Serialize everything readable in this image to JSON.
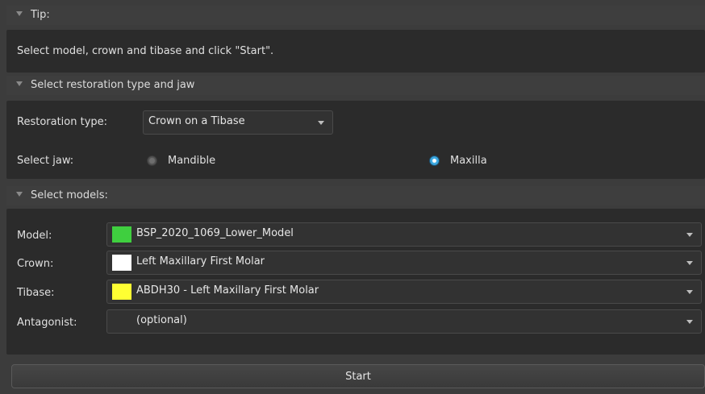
{
  "tip": {
    "header": "Tip:",
    "text": "Select model, crown and tibase and click \"Start\"."
  },
  "restoration": {
    "header": "Select restoration type and jaw",
    "type_label": "Restoration type:",
    "type_value": "Crown on a Tibase",
    "jaw_label": "Select jaw:",
    "options": [
      {
        "label": "Mandible",
        "checked": false
      },
      {
        "label": "Maxilla",
        "checked": true
      }
    ]
  },
  "models": {
    "header": "Select models:",
    "rows": [
      {
        "label": "Model:",
        "value": "BSP_2020_1069_Lower_Model",
        "swatch": "#3fcf3f"
      },
      {
        "label": "Crown:",
        "value": "Left Maxillary First Molar",
        "swatch": "#ffffff"
      },
      {
        "label": "Tibase:",
        "value": "ABDH30 - Left Maxillary First Molar",
        "swatch": "#ffff33"
      },
      {
        "label": "Antagonist:",
        "value": "(optional)",
        "swatch": null
      }
    ]
  },
  "start_label": "Start",
  "colors": {
    "panel_bg": "#3c3c3c",
    "section_bg": "#2b2b2b",
    "accent": "#3aa7e0"
  }
}
